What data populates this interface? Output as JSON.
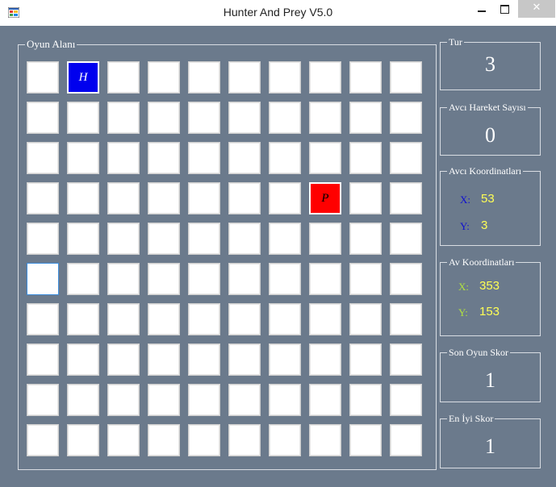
{
  "window": {
    "title": "Hunter And Prey V5.0",
    "close_glyph": "✕"
  },
  "game_area": {
    "label": "Oyun Alanı",
    "rows": 10,
    "cols": 10,
    "hunter": {
      "row": 0,
      "col": 1,
      "glyph": "H"
    },
    "prey": {
      "row": 3,
      "col": 7,
      "glyph": "P"
    },
    "focused": {
      "row": 5,
      "col": 0
    }
  },
  "turn": {
    "label": "Tur",
    "value": "3"
  },
  "hunter_moves": {
    "label": "Avcı Hareket Sayısı",
    "value": "0"
  },
  "hunter_coords": {
    "label": "Avcı Koordinatları",
    "x_label": "X:",
    "x_value": "53",
    "y_label": "Y:",
    "y_value": "3",
    "label_color": "#1010d0"
  },
  "prey_coords": {
    "label": "Av Koordinatları",
    "x_label": "X:",
    "x_value": "353",
    "y_label": "Y:",
    "y_value": "153",
    "label_color": "#b0e040"
  },
  "last_score": {
    "label": "Son Oyun Skor",
    "value": "1"
  },
  "best_score": {
    "label": "En İyi Skor",
    "value": "1"
  },
  "colors": {
    "background": "#6b7a8c",
    "hunter": "#0000ee",
    "prey": "#ff0000",
    "value_yellow": "#ffff55"
  }
}
